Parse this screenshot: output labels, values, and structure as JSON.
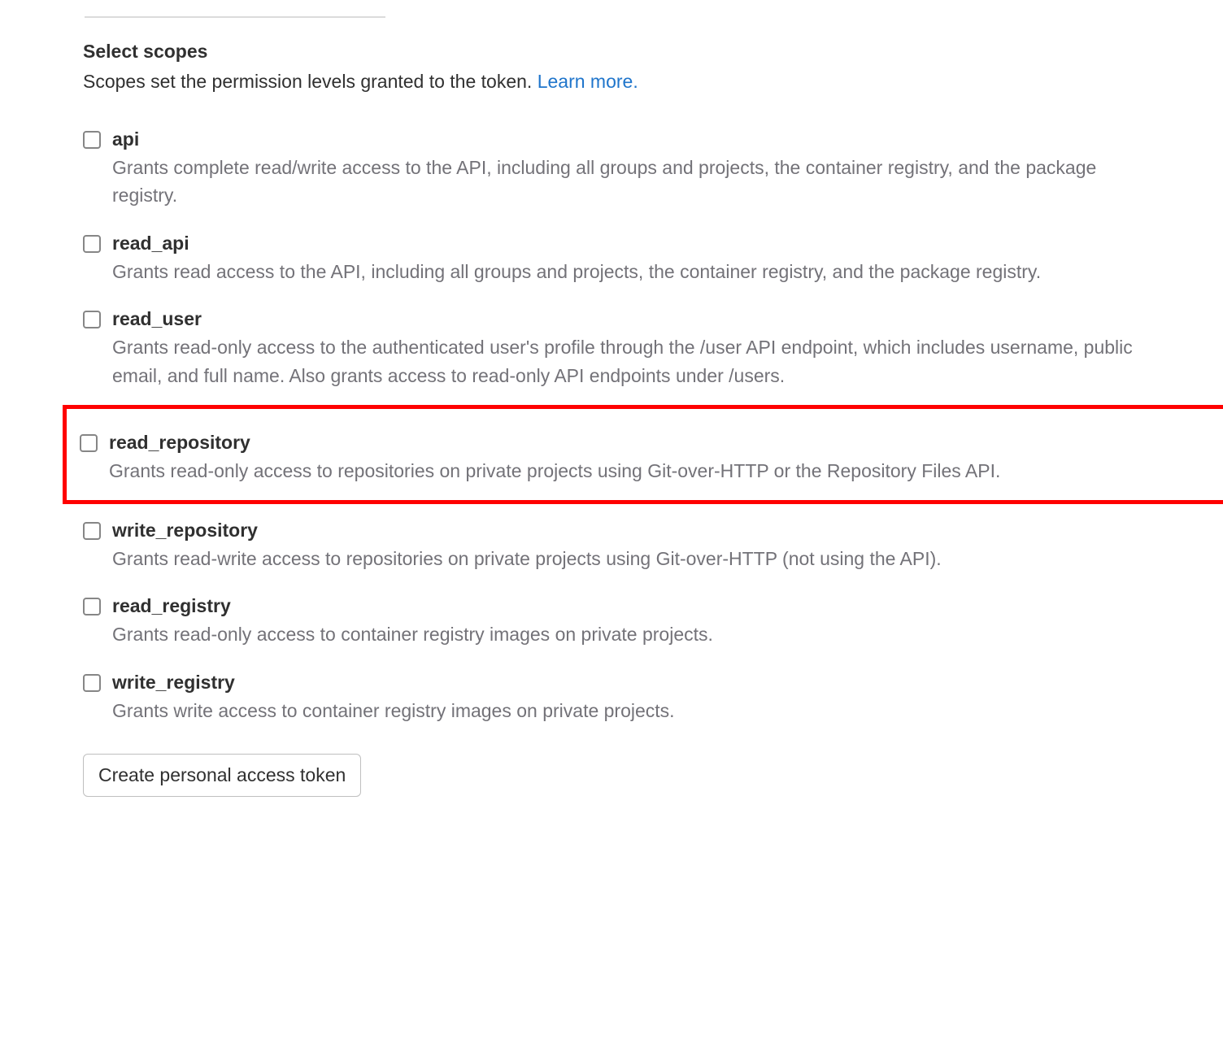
{
  "section": {
    "title": "Select scopes",
    "subtitle": "Scopes set the permission levels granted to the token. ",
    "learn_more": "Learn more."
  },
  "scopes": [
    {
      "key": "api",
      "label": "api",
      "description": "Grants complete read/write access to the API, including all groups and projects, the container registry, and the package registry."
    },
    {
      "key": "read_api",
      "label": "read_api",
      "description": "Grants read access to the API, including all groups and projects, the container registry, and the package registry."
    },
    {
      "key": "read_user",
      "label": "read_user",
      "description": "Grants read-only access to the authenticated user's profile through the /user API endpoint, which includes username, public email, and full name. Also grants access to read-only API endpoints under /users."
    },
    {
      "key": "read_repository",
      "label": "read_repository",
      "description": "Grants read-only access to repositories on private projects using Git-over-HTTP or the Repository Files API."
    },
    {
      "key": "write_repository",
      "label": "write_repository",
      "description": "Grants read-write access to repositories on private projects using Git-over-HTTP (not using the API)."
    },
    {
      "key": "read_registry",
      "label": "read_registry",
      "description": "Grants read-only access to container registry images on private projects."
    },
    {
      "key": "write_registry",
      "label": "write_registry",
      "description": "Grants write access to container registry images on private projects."
    }
  ],
  "button": {
    "create": "Create personal access token"
  }
}
